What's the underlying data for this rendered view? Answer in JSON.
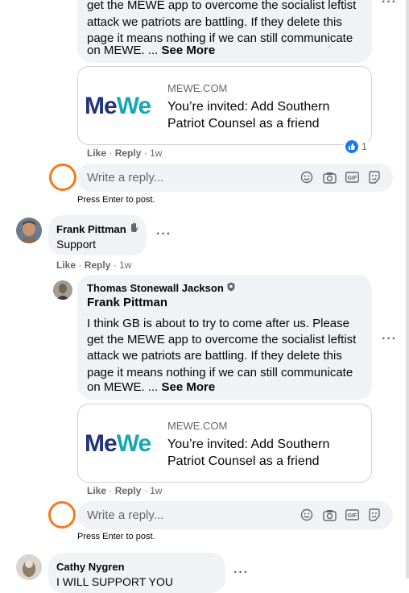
{
  "comment_1": {
    "lines": [
      "get the MEWE app to overcome the socialist leftist",
      "attack we patriots are battling. If they delete this",
      "page it means nothing if we can still communicate",
      "on MEWE. ..."
    ],
    "see_more": "See More",
    "card": {
      "logo": "MeWe",
      "domain": "MEWE.COM",
      "title": "You’re invited: Add Southern Patriot Counsel as a friend"
    },
    "actions": {
      "like": "Like",
      "sep": "·",
      "reply": "Reply",
      "time": "1w"
    },
    "reaction_count": "1"
  },
  "reply_box_1": {
    "placeholder": "Write a reply...",
    "hint": "Press Enter to post."
  },
  "comment_frank": {
    "author": "Frank Pittman",
    "text": "Support",
    "actions": {
      "like": "Like",
      "sep": "·",
      "reply": "Reply",
      "time": "1w"
    }
  },
  "comment_thomas": {
    "author": "Thomas Stonewall Jackson",
    "mention": "Frank Pittman",
    "lines": [
      "I think GB is about to try to come after us. Please",
      "get the MEWE app to overcome the socialist leftist",
      "attack we patriots are battling. If they delete this",
      "page it means nothing if we can still communicate",
      "on MEWE. ..."
    ],
    "see_more": "See More",
    "card": {
      "logo": "MeWe",
      "domain": "MEWE.COM",
      "title": "You’re invited: Add Southern Patriot Counsel as a friend"
    },
    "actions": {
      "like": "Like",
      "sep": "·",
      "reply": "Reply",
      "time": "1w"
    }
  },
  "reply_box_2": {
    "placeholder": "Write a reply...",
    "hint": "Press Enter to post."
  },
  "comment_cathy": {
    "author": "Cathy Nygren",
    "text": "I WILL SUPPORT YOU"
  },
  "icons": [
    "smiley-icon",
    "camera-icon",
    "gif-icon",
    "sticker-icon",
    "more-dots-icon",
    "like-thumb-icon",
    "raised-hand-icon",
    "shield-badge-icon"
  ],
  "colors": {
    "accent_orange": "#f47920",
    "facebook_blue": "#1877f2",
    "mewe_navy": "#21337c",
    "mewe_teal": "#18a7b5"
  }
}
